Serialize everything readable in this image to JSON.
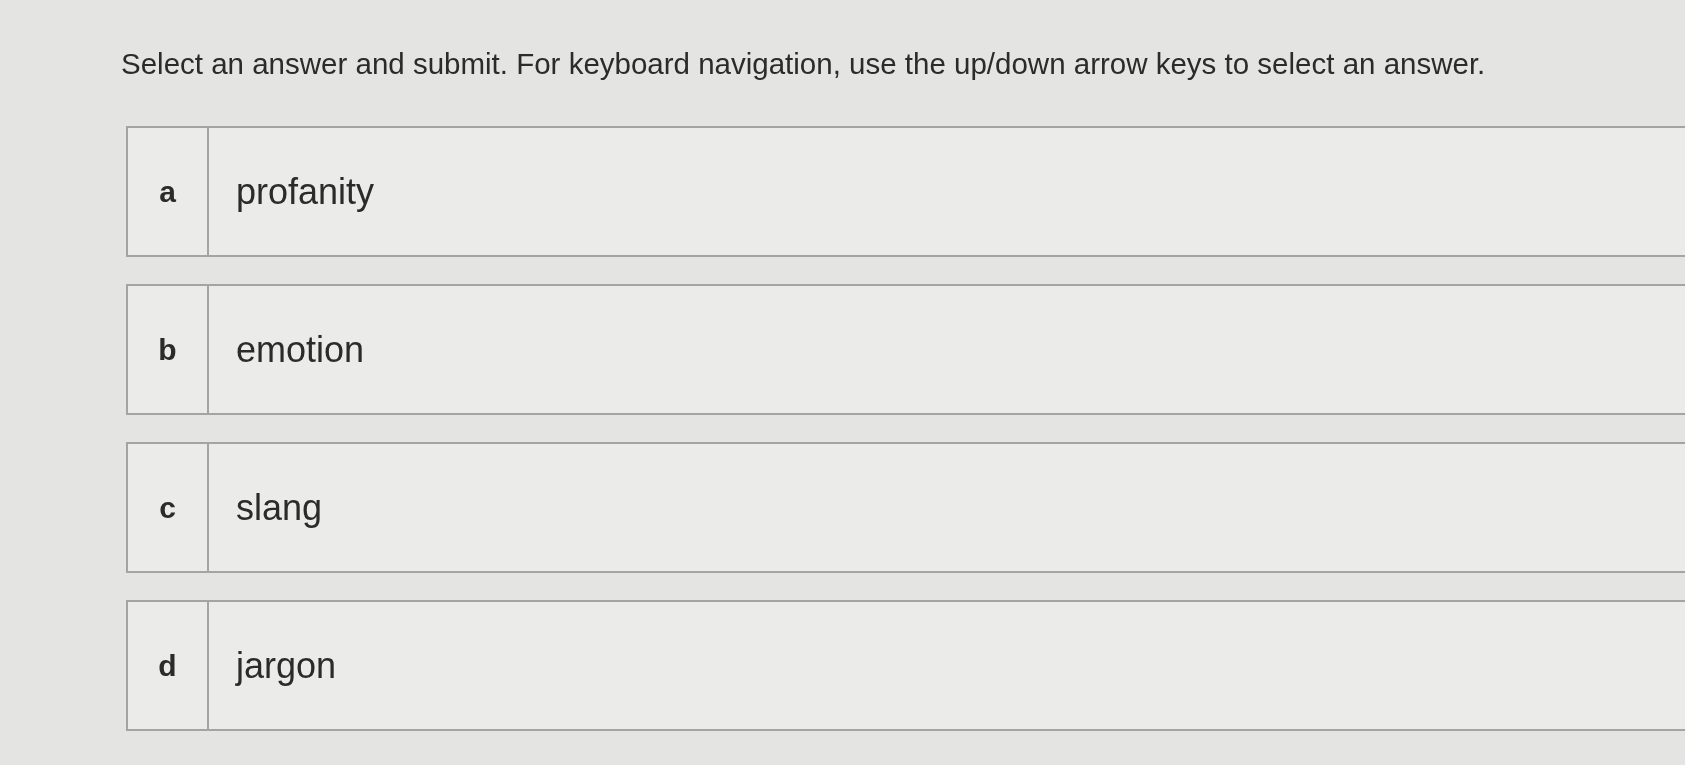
{
  "instruction": "Select an answer and submit. For keyboard navigation, use the up/down arrow keys to select an answer.",
  "options": [
    {
      "letter": "a",
      "text": "profanity",
      "selected": false
    },
    {
      "letter": "b",
      "text": "emotion",
      "selected": false
    },
    {
      "letter": "c",
      "text": "slang",
      "selected": false
    },
    {
      "letter": "d",
      "text": "jargon",
      "selected": false
    }
  ]
}
